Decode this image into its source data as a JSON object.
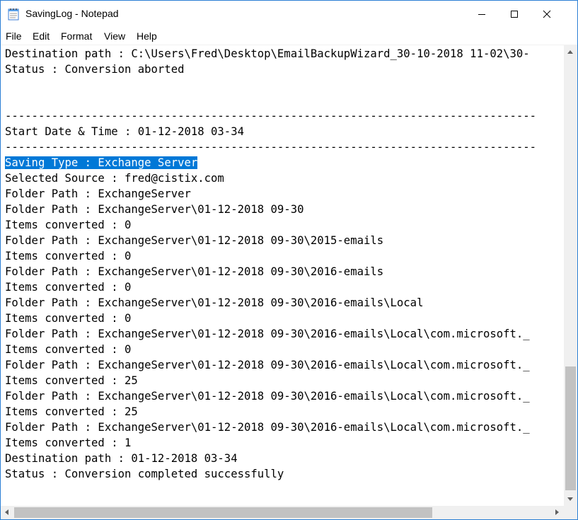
{
  "window": {
    "title": "SavingLog - Notepad",
    "app_icon": "notepad-icon"
  },
  "menu": [
    "File",
    "Edit",
    "Format",
    "View",
    "Help"
  ],
  "document": {
    "lines": [
      "Destination path : C:\\Users\\Fred\\Desktop\\EmailBackupWizard_30-10-2018 11-02\\30-",
      "Status : Conversion aborted",
      "",
      "",
      "--------------------------------------------------------------------------------",
      "Start Date & Time : 01-12-2018 03-34",
      "--------------------------------------------------------------------------------",
      "Saving Type : Exchange Server",
      "Selected Source : fred@cistix.com",
      "Folder Path : ExchangeServer",
      "Folder Path : ExchangeServer\\01-12-2018 09-30",
      "Items converted : 0",
      "Folder Path : ExchangeServer\\01-12-2018 09-30\\2015-emails",
      "Items converted : 0",
      "Folder Path : ExchangeServer\\01-12-2018 09-30\\2016-emails",
      "Items converted : 0",
      "Folder Path : ExchangeServer\\01-12-2018 09-30\\2016-emails\\Local",
      "Items converted : 0",
      "Folder Path : ExchangeServer\\01-12-2018 09-30\\2016-emails\\Local\\com.microsoft._",
      "Items converted : 0",
      "Folder Path : ExchangeServer\\01-12-2018 09-30\\2016-emails\\Local\\com.microsoft._",
      "Items converted : 25",
      "Folder Path : ExchangeServer\\01-12-2018 09-30\\2016-emails\\Local\\com.microsoft._",
      "Items converted : 25",
      "Folder Path : ExchangeServer\\01-12-2018 09-30\\2016-emails\\Local\\com.microsoft._",
      "Items converted : 1",
      "Destination path : 01-12-2018 03-34",
      "Status : Conversion completed successfully"
    ],
    "selected_line_index": 7
  },
  "colors": {
    "selection_bg": "#0078d7",
    "selection_fg": "#ffffff",
    "window_border": "#2b7fd4"
  }
}
